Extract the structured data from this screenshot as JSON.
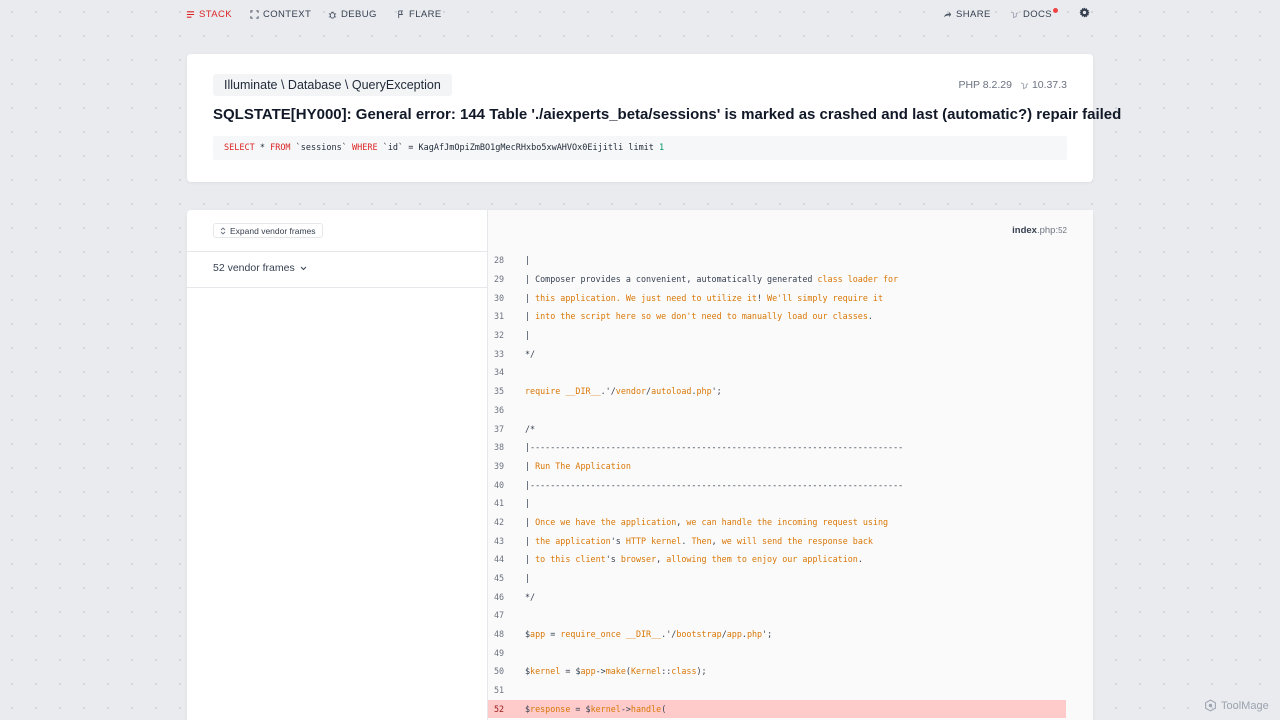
{
  "nav": {
    "stack": "STACK",
    "context": "CONTEXT",
    "debug": "DEBUG",
    "flare": "FLARE",
    "share": "SHARE",
    "docs": "DOCS"
  },
  "exception": {
    "class": "Illuminate \\ Database \\ QueryException",
    "php_version": "PHP 8.2.29",
    "laravel_version": "10.37.3",
    "message": "SQLSTATE[HY000]: General error: 144 Table './aiexperts_beta/sessions' is marked as crashed and last (automatic?) repair failed",
    "sql": {
      "select": "SELECT",
      "star": " * ",
      "from": "FROM",
      "table": " `sessions` ",
      "where": "WHERE",
      "condition": " `id` = KagAfJmOpiZmBO1gMecRHxbo5xwAHVOx0Eijitli limit ",
      "limit": "1"
    }
  },
  "stack": {
    "expand_label": "Expand vendor frames",
    "vendor_frames": "52 vendor frames",
    "file_name": "index",
    "file_ext": ".php",
    "file_line": "52",
    "highlight_line": 52,
    "lines": [
      {
        "n": "28",
        "segs": [
          [
            "| ",
            ""
          ]
        ]
      },
      {
        "n": "29",
        "segs": [
          [
            "| Composer provides a convenient, automatically generated ",
            ""
          ],
          [
            "class loader for",
            "o"
          ]
        ]
      },
      {
        "n": "30",
        "segs": [
          [
            "| ",
            ""
          ],
          [
            "this application. We just need to utilize it",
            "o"
          ],
          [
            "! ",
            ""
          ],
          [
            "We'll simply require it",
            "o"
          ]
        ]
      },
      {
        "n": "31",
        "segs": [
          [
            "| ",
            ""
          ],
          [
            "into the script here so we don't need to manually load our classes",
            "o"
          ],
          [
            ".",
            ""
          ]
        ]
      },
      {
        "n": "32",
        "segs": [
          [
            "|",
            ""
          ]
        ]
      },
      {
        "n": "33",
        "segs": [
          [
            "*/",
            ""
          ]
        ]
      },
      {
        "n": "34",
        "segs": [
          [
            "",
            ""
          ]
        ]
      },
      {
        "n": "35",
        "segs": [
          [
            "require __DIR__",
            "o"
          ],
          [
            ".'/",
            ""
          ],
          [
            "vendor",
            "o"
          ],
          [
            "/",
            ""
          ],
          [
            "autoload",
            "o"
          ],
          [
            ".",
            ""
          ],
          [
            "php",
            "o"
          ],
          [
            "';",
            ""
          ]
        ]
      },
      {
        "n": "36",
        "segs": [
          [
            "",
            ""
          ]
        ]
      },
      {
        "n": "37",
        "segs": [
          [
            "/*",
            ""
          ]
        ]
      },
      {
        "n": "38",
        "segs": [
          [
            "|--------------------------------------------------------------------------",
            ""
          ]
        ]
      },
      {
        "n": "39",
        "segs": [
          [
            "| ",
            ""
          ],
          [
            "Run The Application",
            "o"
          ]
        ]
      },
      {
        "n": "40",
        "segs": [
          [
            "|--------------------------------------------------------------------------",
            ""
          ]
        ]
      },
      {
        "n": "41",
        "segs": [
          [
            "|",
            ""
          ]
        ]
      },
      {
        "n": "42",
        "segs": [
          [
            "| ",
            ""
          ],
          [
            "Once we have the application",
            "o"
          ],
          [
            ", ",
            ""
          ],
          [
            "we can handle the incoming request using",
            "o"
          ]
        ]
      },
      {
        "n": "43",
        "segs": [
          [
            "| ",
            ""
          ],
          [
            "the application",
            "o"
          ],
          [
            "'s ",
            ""
          ],
          [
            "HTTP kernel",
            "o"
          ],
          [
            ". ",
            ""
          ],
          [
            "Then",
            "o"
          ],
          [
            ", ",
            ""
          ],
          [
            "we will send the response back",
            "o"
          ]
        ]
      },
      {
        "n": "44",
        "segs": [
          [
            "| ",
            ""
          ],
          [
            "to this client",
            "o"
          ],
          [
            "'s ",
            ""
          ],
          [
            "browser",
            "o"
          ],
          [
            ", ",
            ""
          ],
          [
            "allowing them to enjoy our application",
            "o"
          ],
          [
            ".",
            ""
          ]
        ]
      },
      {
        "n": "45",
        "segs": [
          [
            "|",
            ""
          ]
        ]
      },
      {
        "n": "46",
        "segs": [
          [
            "*/",
            ""
          ]
        ]
      },
      {
        "n": "47",
        "segs": [
          [
            "",
            ""
          ]
        ]
      },
      {
        "n": "48",
        "segs": [
          [
            "$",
            ""
          ],
          [
            "app",
            "o"
          ],
          [
            " = ",
            ""
          ],
          [
            "require_once __DIR__",
            "o"
          ],
          [
            ".'/",
            ""
          ],
          [
            "bootstrap",
            "o"
          ],
          [
            "/",
            ""
          ],
          [
            "app",
            "o"
          ],
          [
            ".",
            ""
          ],
          [
            "php",
            "o"
          ],
          [
            "';",
            ""
          ]
        ]
      },
      {
        "n": "49",
        "segs": [
          [
            "",
            ""
          ]
        ]
      },
      {
        "n": "50",
        "segs": [
          [
            "$",
            ""
          ],
          [
            "kernel",
            "o"
          ],
          [
            " = $",
            ""
          ],
          [
            "app",
            "o"
          ],
          [
            "->",
            ""
          ],
          [
            "make",
            "o"
          ],
          [
            "(",
            ""
          ],
          [
            "Kernel",
            "o"
          ],
          [
            "::",
            ""
          ],
          [
            "class",
            "o"
          ],
          [
            ");",
            ""
          ]
        ]
      },
      {
        "n": "51",
        "segs": [
          [
            "",
            ""
          ]
        ]
      },
      {
        "n": "52",
        "segs": [
          [
            "$",
            ""
          ],
          [
            "response",
            "o"
          ],
          [
            " = $",
            ""
          ],
          [
            "kernel",
            "o"
          ],
          [
            "->",
            ""
          ],
          [
            "handle",
            "o"
          ],
          [
            "(",
            ""
          ]
        ]
      }
    ]
  },
  "watermark": "ToolMage",
  "colors": {
    "accent": "#dc2626",
    "code_keyword": "#d97706",
    "highlight_bg": "#fecaca"
  }
}
